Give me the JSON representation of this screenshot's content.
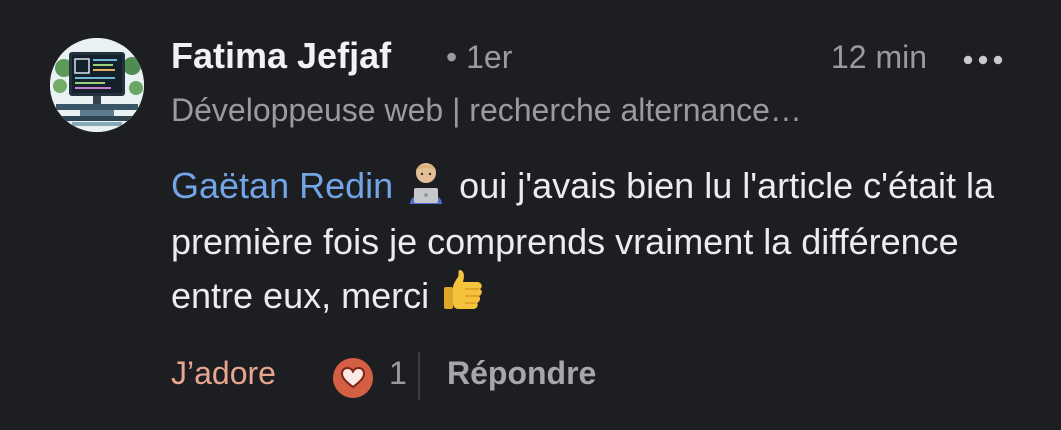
{
  "author": {
    "name": "Fatima Jefjaf",
    "degree": "• 1er",
    "headline": "Développeuse web | recherche alternance…",
    "avatar": "avatar-illustration-developer-desk"
  },
  "time": "12 min",
  "more_icon": "more-dots-icon",
  "comment": {
    "mention": "Gaëtan Redin",
    "mention_emoji": "person-with-laptop-emoji",
    "text": " oui j'avais bien lu l'article c'était la première fois je comprends vraiment la différence entre eux, merci ",
    "trailing_emoji": "thumbs-up-emoji"
  },
  "actions": {
    "like_label": "J’adore",
    "reaction_icon": "heart-reaction-icon",
    "reaction_count": "1",
    "reply_label": "Répondre"
  },
  "colors": {
    "background": "#1d1e22",
    "mention": "#71a5e6",
    "liked": "#e8a58f",
    "reaction_badge": "#d45f45",
    "muted": "#9a9ba1"
  }
}
